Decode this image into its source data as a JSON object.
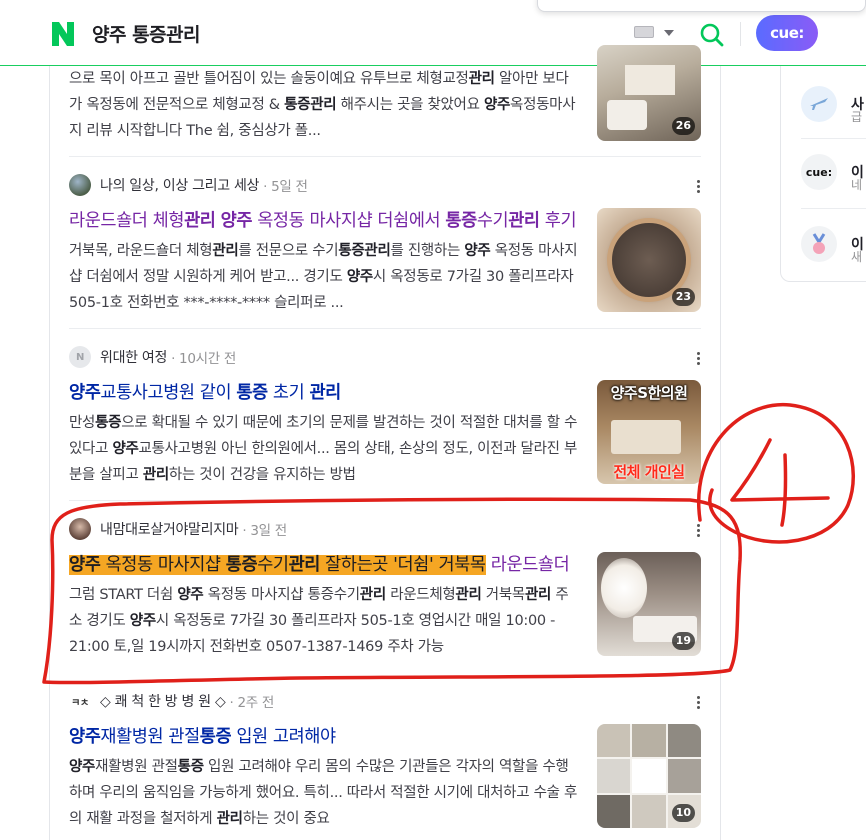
{
  "header": {
    "logo_letter": "N",
    "query": "양주 통증관리",
    "cue_label": "cue:"
  },
  "results": [
    {
      "snippet_html": "으로 목이 아프고 골반 틀어짐이 있는 솔둥이예요 유투브로 체형교정<b>관리</b> 알아만 보다가 옥정동에 전문적으로 체형교정 & <b>통증관리</b> 해주시는 곳을 찾았어요 <b>양주</b>옥정동마사지 리뷰 시작합니다 The 쉼, 중심상가 폴...",
      "thumb_count": "26"
    },
    {
      "author": "나의 일상, 이상 그리고 세상",
      "time": "5일 전",
      "title_html": "라운드숄더 체형<b>관리</b> <b>양주</b> 옥정동 마사지샵 더쉼에서 <b>통증</b>수기<b>관리</b> 후기",
      "snippet_html": "거북목, 라운드숄더 체형<b>관리</b>를 전문으로 수기<b>통증관리</b>를 진행하는 <b>양주</b> 옥정동 마사지샵 더쉼에서 정말 시원하게 케어 받고... 경기도 <b>양주</b>시 옥정동로 7가길 30 폴리프라자 505-1호 전화번호 ***-****-**** 슬리퍼로 ...",
      "thumb_count": "23"
    },
    {
      "author": "위대한 여정",
      "time": "10시간 전",
      "title_html": "<b>양주</b>교통사고병원 같이 <b>통증</b> 초기 <b>관리</b>",
      "snippet_html": "만성<b>통증</b>으로 확대될 수 있기 때문에 초기의 문제를 발견하는 것이 적절한 대처를 할 수 있다고 <b>양주</b>교통사고병원 아닌 한의원에서... 몸의 상태, 손상의 정도, 이전과 달라진 부분을 살피고 <b>관리</b>하는 것이 건강을 유지하는 방법",
      "thumb_top_text": "양주S한의원",
      "thumb_bottom_text": "전체 개인실"
    },
    {
      "author": "내맘대로살거야말리지마",
      "time": "3일 전",
      "title_hl": "<b>양주</b> 옥정동 마사지샵 <b>통증</b>수기<b>관리</b> 잘하는곳 '더쉼' 거북목",
      "title_rest": " 라운드숄더",
      "snippet_html": "그럼 START 더쉼 <b>양주</b> 옥정동 마사지샵 통증수기<b>관리</b> 라운드체형<b>관리</b> 거북목<b>관리</b> 주소 경기도 <b>양주</b>시 옥정동로 7가길 30 폴리프라자 505-1호 영업시간 매일 10:00 - 21:00 토,일 19시까지 전화번호 0507-1387-1469 주차 가능",
      "thumb_count": "19"
    },
    {
      "author": "◇ 쾌 척 한 방 병 원 ◇",
      "time": "2주 전",
      "title_html": "<b>양주</b>재활병원 관절<b>통증</b> 입원 고려해야",
      "snippet_html": "<b>양주</b>재활병원 관절<b>통증</b> 입원 고려해야 우리 몸의 수많은 기관들은 각자의 역할을 수행하며 우리의 움직임을 가능하게 했어요. 특히... 따라서 적절한 시기에 대처하고 수술 후의 재활 과정을 철저하게 <b>관리</b>하는 것이 중요",
      "thumb_count": "10"
    }
  ],
  "right_panel": [
    {
      "label": "사",
      "sub": "급"
    },
    {
      "label": "이",
      "sub": "네"
    },
    {
      "label": "이",
      "sub": "새"
    }
  ],
  "annotation": {
    "number": "4",
    "color": "#e0201a"
  }
}
